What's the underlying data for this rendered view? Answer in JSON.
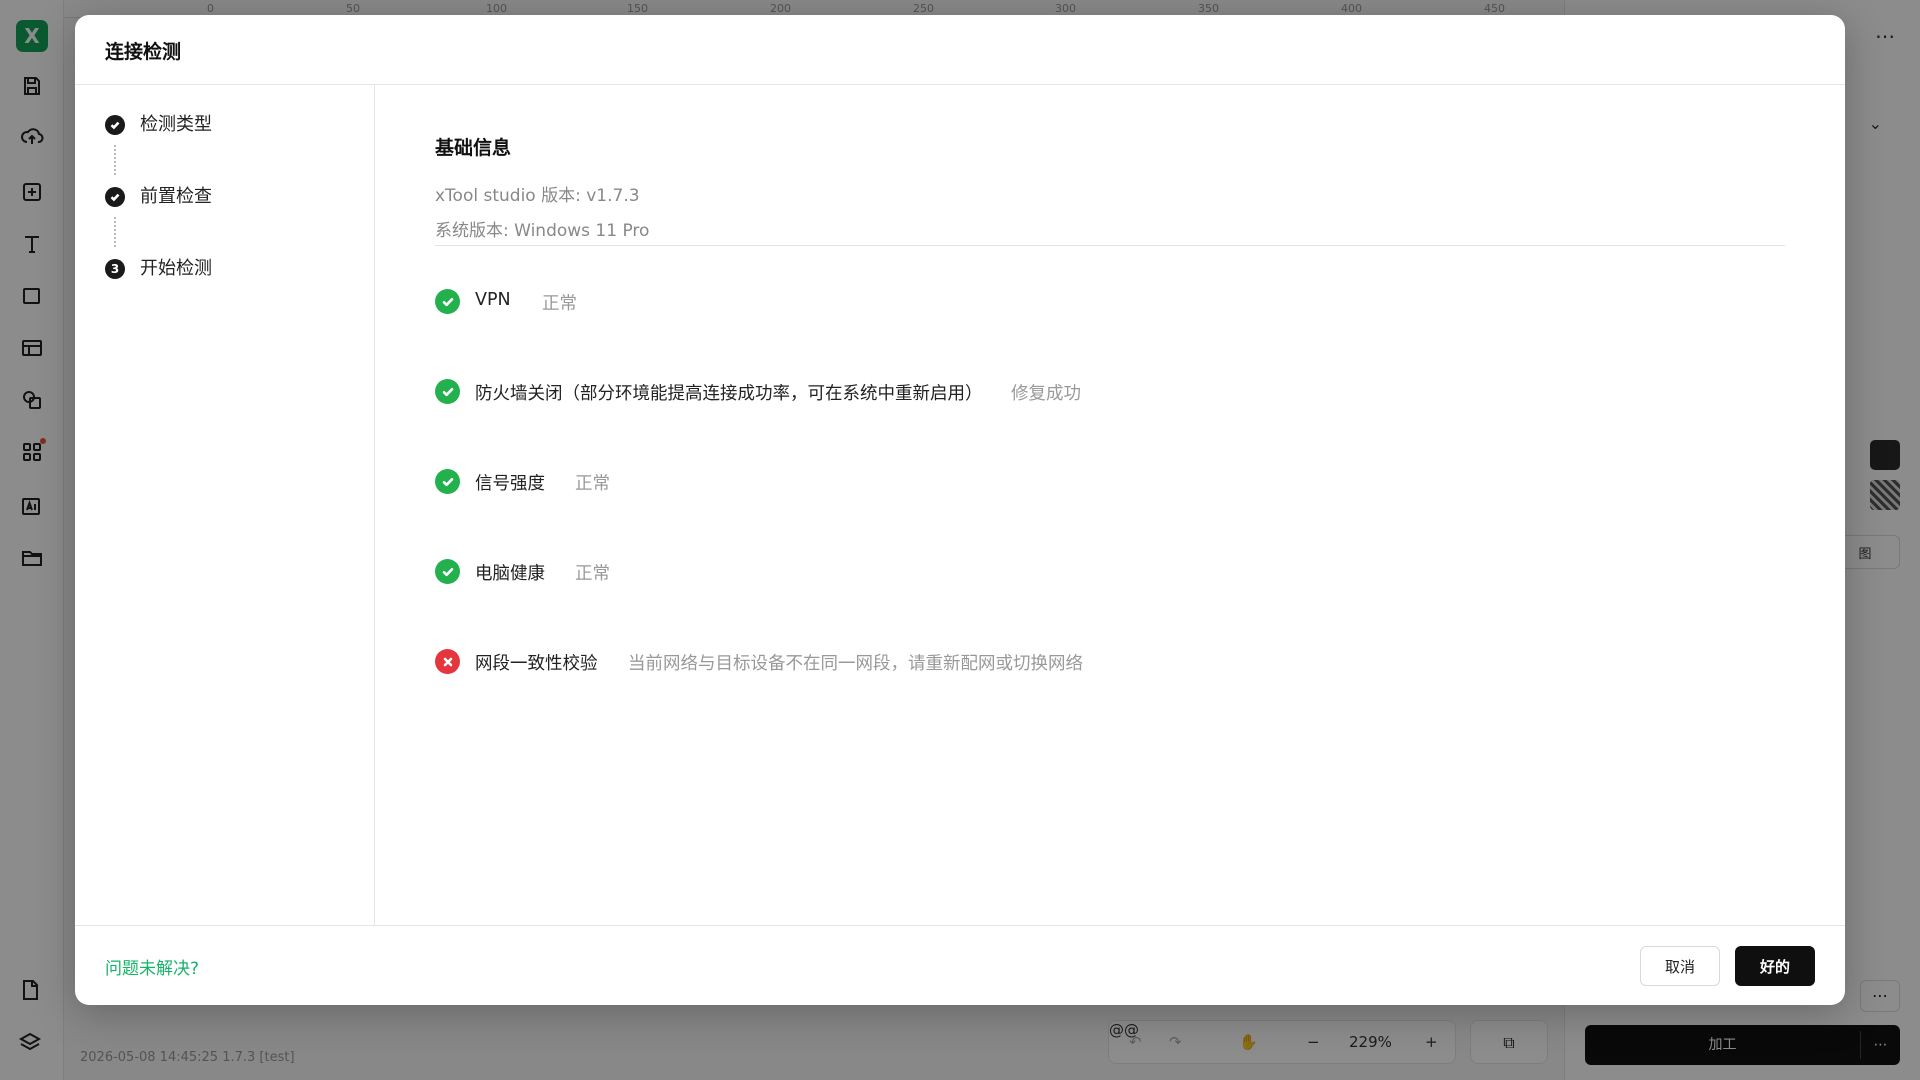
{
  "background": {
    "ruler_ticks": [
      "0",
      "50",
      "100",
      "150",
      "200",
      "250",
      "300",
      "350",
      "400",
      "450"
    ],
    "right_panel": {
      "side_btn_label": "图",
      "process_label": "加工",
      "more_glyph": "⋯"
    },
    "zoom": {
      "undo": "↶",
      "redo": "↷",
      "hand": "✋",
      "minus": "−",
      "value": "229%",
      "plus": "+"
    },
    "copy_glyph": "⧉",
    "status_text": "2026-05-08 14:45:25 1.7.3 [test]",
    "logo_glyph": "X"
  },
  "modal": {
    "title": "连接检测",
    "steps": [
      {
        "label": "检测类型",
        "state": "done"
      },
      {
        "label": "前置检查",
        "state": "done"
      },
      {
        "label": "开始检测",
        "state": "active",
        "number": "3"
      }
    ],
    "section_title": "基础信息",
    "info": {
      "studio_version": "xTool studio 版本: v1.7.3",
      "system_version": "系统版本: Windows 11 Pro"
    },
    "checks": [
      {
        "name": "VPN",
        "status": "正常",
        "result": "ok"
      },
      {
        "name": "防火墙关闭（部分环境能提高连接成功率，可在系统中重新启用）",
        "status": "修复成功",
        "result": "ok"
      },
      {
        "name": "信号强度",
        "status": "正常",
        "result": "ok"
      },
      {
        "name": "电脑健康",
        "status": "正常",
        "result": "ok"
      },
      {
        "name": "网段一致性校验",
        "status": "当前网络与目标设备不在同一网段，请重新配网或切换网络",
        "result": "fail"
      }
    ],
    "footer": {
      "help_link": "问题未解决?",
      "cancel_label": "取消",
      "ok_label": "好的"
    }
  },
  "colors": {
    "success": "#22b14c",
    "error": "#e5363d",
    "link": "#17b369",
    "primary_button": "#0f0f0f"
  }
}
